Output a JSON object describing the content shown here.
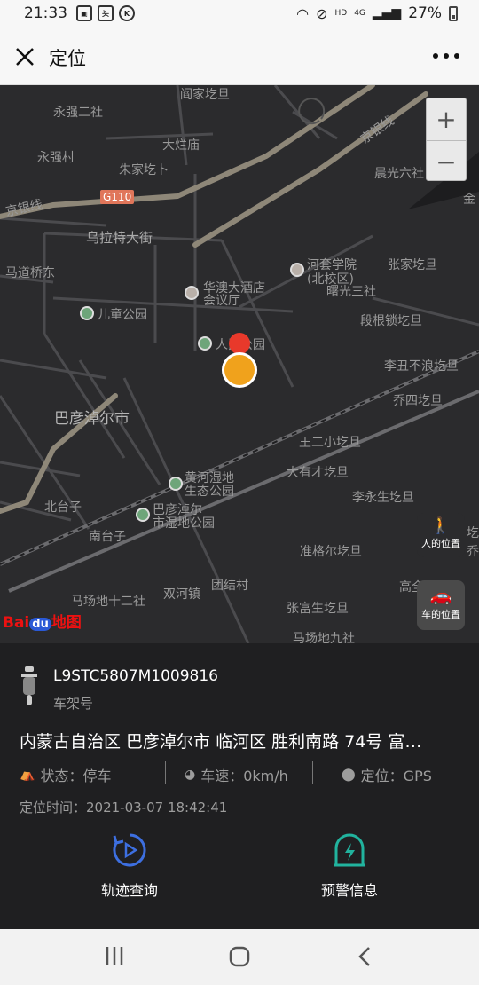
{
  "status_bar": {
    "time": "21:33",
    "left_icons": [
      "image-icon",
      "toutiao-icon",
      "k-icon"
    ],
    "battery": "27%",
    "network": "4G",
    "hd": "HD"
  },
  "nav": {
    "title": "定位"
  },
  "map": {
    "labels": {
      "yanjia": "阎家圪旦",
      "yongqiang2": "永强二社",
      "dalanmiao": "大烂庙",
      "yongqiangcun": "永强村",
      "zhujia": "朱家圪卜",
      "jingyin1": "京银线",
      "jingyin2": "京银线",
      "chenguang6": "晨光六社",
      "jin": "金",
      "road_g110": "G110",
      "wulate": "乌拉特大街",
      "madaoqiao": "马道桥东",
      "hetao": "河套学院",
      "hetao_sub": "(北校区)",
      "zhangjia": "张家圪旦",
      "huaao": "华澳大酒店",
      "huiyi": "会议厅",
      "shuguang3": "曙光三社",
      "ertong": "儿童公园",
      "duangen": "段根锁圪旦",
      "renmin": "人民公园",
      "lichou": "李丑不浪圪旦",
      "bayan": "巴彦淖尔市",
      "qiaosi": "乔四圪旦",
      "wang2": "王二小圪旦",
      "dayoucai": "大有才圪旦",
      "huanghe1": "黄河湿地",
      "huanghe2": "生态公园",
      "liyongsheng": "李永生圪旦",
      "beitaizi": "北台子",
      "bayan_wet1": "巴彦淖尔",
      "bayan_wet2": "市湿地公园",
      "nantaizi": "南台子",
      "zhungeer": "准格尔圪旦",
      "masd12": "马场地十二社",
      "shuanghe": "双河镇",
      "tuanjie": "团结村",
      "gaoquan": "高全",
      "zhangfusheng": "张富生圪旦",
      "masd9": "马场地九社",
      "qiao": "乔",
      "ge": "圪"
    },
    "zoom_in": "+",
    "zoom_out": "−",
    "person_location_label": "人的位置",
    "car_location_label": "车的位置",
    "logo": {
      "bai": "Bai",
      "du": "du",
      "ditu": "地图"
    }
  },
  "vehicle": {
    "vin": "L9STC5807M1009816",
    "vin_label": "车架号",
    "address": "内蒙古自治区 巴彦淖尔市 临河区 胜利南路 74号 富…",
    "status": "状态：停车",
    "speed": "车速：0km/h",
    "locate_mode": "定位：GPS",
    "locate_time": "定位时间：2021-03-07 18:42:41"
  },
  "actions": {
    "track": "轨迹查询",
    "alert": "预警信息"
  },
  "colors": {
    "map_bg": "#2b2b2d",
    "info_bg": "#1f1f21",
    "track_icon": "#3d6fe0",
    "alert_icon": "#21b39e",
    "marker_red": "#e8392b",
    "marker_orange": "#f0a21c"
  }
}
